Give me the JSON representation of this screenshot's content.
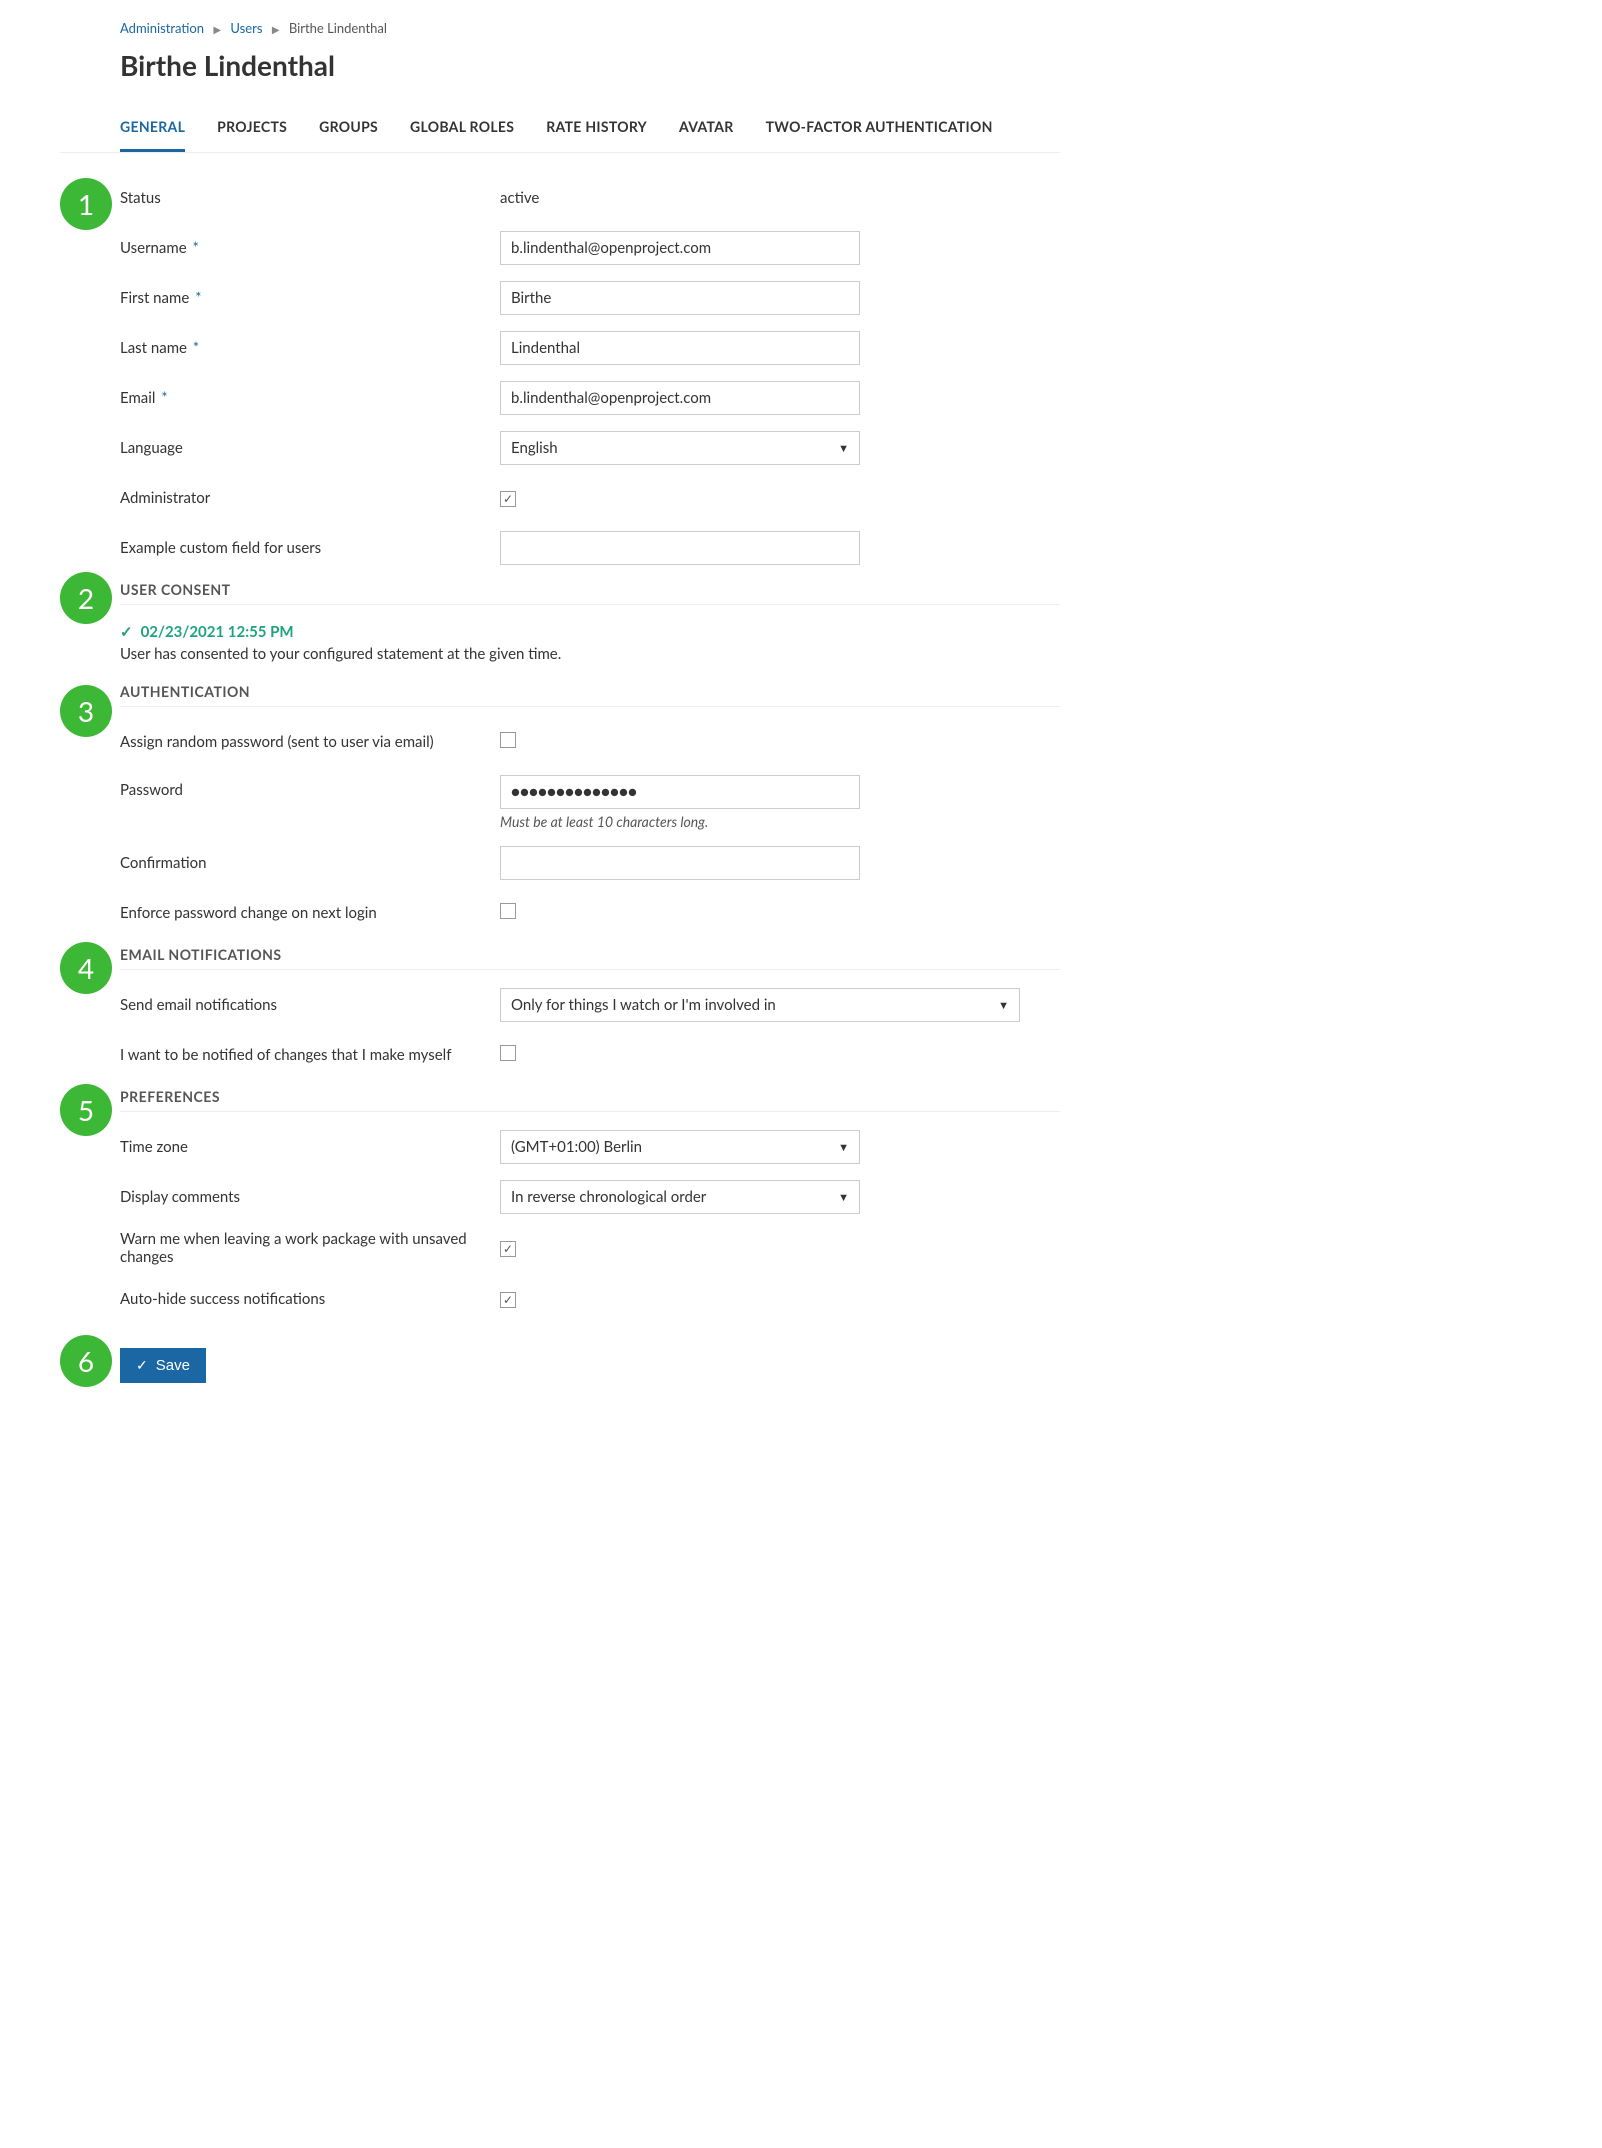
{
  "breadcrumb": {
    "admin": "Administration",
    "users": "Users",
    "current": "Birthe Lindenthal"
  },
  "page_title": "Birthe Lindenthal",
  "tabs": {
    "general": "GENERAL",
    "projects": "PROJECTS",
    "groups": "GROUPS",
    "global_roles": "GLOBAL ROLES",
    "rate_history": "RATE HISTORY",
    "avatar": "AVATAR",
    "two_factor": "TWO-FACTOR AUTHENTICATION"
  },
  "badges": {
    "b1": "1",
    "b2": "2",
    "b3": "3",
    "b4": "4",
    "b5": "5",
    "b6": "6"
  },
  "general": {
    "status_label": "Status",
    "status_value": "active",
    "username_label": "Username",
    "username_value": "b.lindenthal@openproject.com",
    "firstname_label": "First name",
    "firstname_value": "Birthe",
    "lastname_label": "Last name",
    "lastname_value": "Lindenthal",
    "email_label": "Email",
    "email_value": "b.lindenthal@openproject.com",
    "language_label": "Language",
    "language_value": "English",
    "admin_label": "Administrator",
    "custom_label": "Example custom field for users",
    "custom_value": ""
  },
  "consent": {
    "heading": "USER CONSENT",
    "timestamp": "02/23/2021 12:55 PM",
    "desc": "User has consented to your configured statement at the given time."
  },
  "auth": {
    "heading": "AUTHENTICATION",
    "assign_random_label": "Assign random password (sent to user via email)",
    "password_label": "Password",
    "password_value": "●●●●●●●●●●●●●●",
    "password_hint": "Must be at least 10 characters long.",
    "confirmation_label": "Confirmation",
    "confirmation_value": "",
    "enforce_label": "Enforce password change on next login"
  },
  "email": {
    "heading": "EMAIL NOTIFICATIONS",
    "send_label": "Send email notifications",
    "send_value": "Only for things I watch or I'm involved in",
    "self_notify_label": "I want to be notified of changes that I make myself"
  },
  "prefs": {
    "heading": "PREFERENCES",
    "tz_label": "Time zone",
    "tz_value": "(GMT+01:00) Berlin",
    "comments_label": "Display comments",
    "comments_value": "In reverse chronological order",
    "warn_label": "Warn me when leaving a work package with unsaved changes",
    "autohide_label": "Auto-hide success notifications"
  },
  "save_label": "Save"
}
